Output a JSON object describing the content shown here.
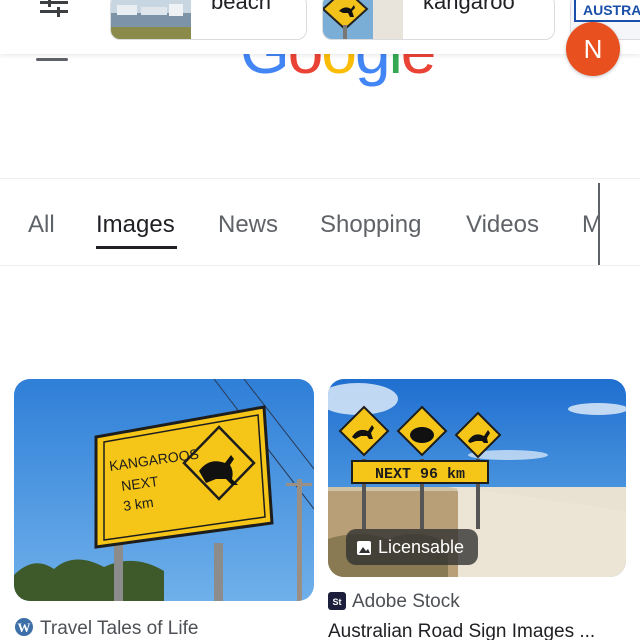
{
  "chips": [
    {
      "label": "beach"
    },
    {
      "label": "kangaroo"
    },
    {
      "label": "AUSTRALIA"
    }
  ],
  "avatar": {
    "initial": "N",
    "color": "#e8501f"
  },
  "logo": {
    "letters": [
      "G",
      "o",
      "o",
      "g",
      "l",
      "e"
    ]
  },
  "tabs": [
    {
      "label": "All"
    },
    {
      "label": "Images"
    },
    {
      "label": "News"
    },
    {
      "label": "Shopping"
    },
    {
      "label": "Videos"
    },
    {
      "label": "M"
    }
  ],
  "active_tab": "Images",
  "results": [
    {
      "sign_text": [
        "KANGAROOS",
        "NEXT",
        "3 km"
      ],
      "source": "Travel Tales of Life",
      "favicon": "wordpress-icon"
    },
    {
      "sign_text": "NEXT 96 km",
      "badge": "Licensable",
      "source": "Adobe Stock",
      "favicon_text": "St",
      "title": "Australian Road Sign Images ..."
    }
  ],
  "colors": {
    "accent_text": "#202124",
    "muted_text": "#5f6368",
    "google_blue": "#4285f4",
    "google_red": "#ea4335",
    "google_yellow": "#fbbc05",
    "google_green": "#34a853"
  }
}
